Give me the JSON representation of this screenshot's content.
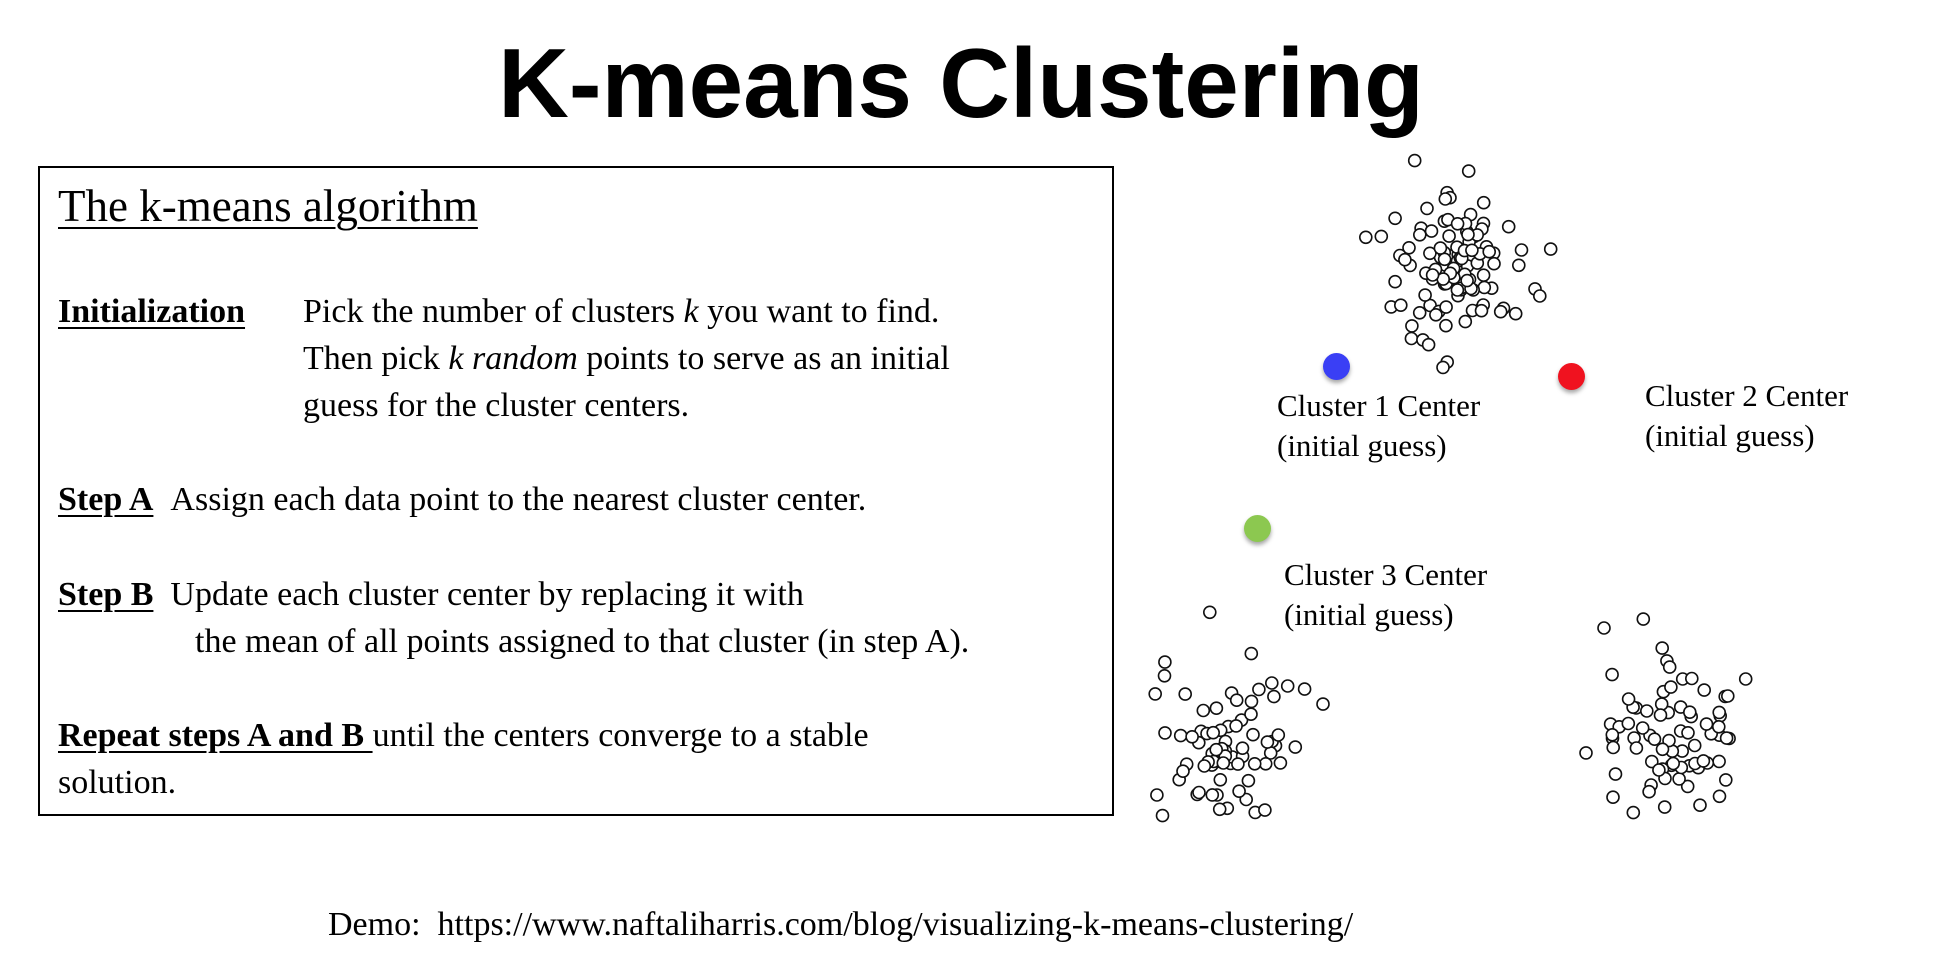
{
  "title": "K-means Clustering",
  "algorithm": {
    "heading": "The k-means algorithm",
    "initialization": {
      "label": "Initialization",
      "line1_pre": "Pick the number of clusters ",
      "line1_k": "k",
      "line1_post": " you want to find.",
      "line2_pre": "Then pick ",
      "line2_k": "k",
      "line2_random": "random",
      "line2_post": " points to serve as an initial",
      "line3": "guess for the cluster centers."
    },
    "step_a": {
      "label": "Step A",
      "text": "Assign each data point to the nearest cluster center."
    },
    "step_b": {
      "label": "Step B",
      "line1": "Update each cluster center by replacing it with",
      "line2": "the mean of all points assigned to that cluster (in step A)."
    },
    "repeat": {
      "label": "Repeat steps A and B ",
      "line1": "until the centers converge to a stable",
      "line2": "solution."
    }
  },
  "centers": [
    {
      "name": "Cluster 1 Center",
      "note": "(initial guess)",
      "color": "#3a3ff5"
    },
    {
      "name": "Cluster 2 Center",
      "note": "(initial guess)",
      "color": "#f0121f"
    },
    {
      "name": "Cluster 3 Center",
      "note": "(initial guess)",
      "color": "#8cc850"
    }
  ],
  "demo": {
    "label": "Demo:",
    "url": "https://www.naftaliharris.com/blog/visualizing-k-means-clustering/"
  }
}
